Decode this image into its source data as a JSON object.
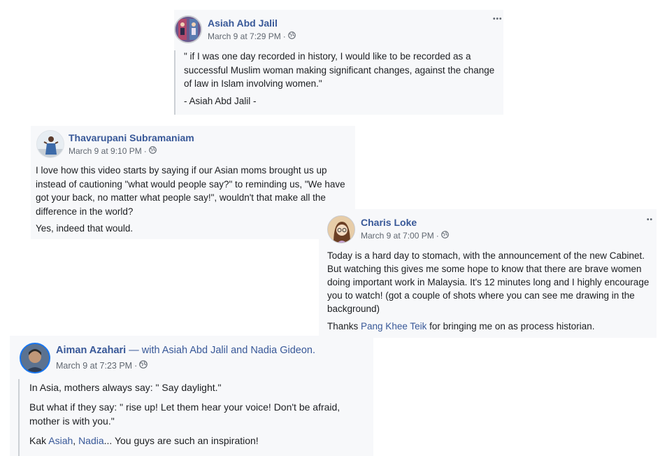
{
  "posts": [
    {
      "author": "Asiah Abd Jalil",
      "time": "March 9 at 7:29 PM",
      "separator": "·",
      "lines": [
        "\" if I was one day recorded in history, I would like to be recorded as a",
        "successful Muslim woman making significant changes, against the change",
        "of law in Islam involving women.\""
      ],
      "signature": "- Asiah Abd Jalil -",
      "more": "•••",
      "avatar_icon": "profile-photo",
      "privacy_icon": "globe-icon"
    },
    {
      "author": "Thavarupani Subramaniam",
      "time": "March 9 at 9:10 PM",
      "separator": "·",
      "lines": [
        "I love how this video starts by saying if our Asian moms brought us up",
        "instead of cautioning \"what would people say?\" to reminding us, \"We have",
        "got your back, no matter what people say!\", wouldn't that make all the",
        "difference in the world?"
      ],
      "followup": "Yes, indeed that would.",
      "avatar_icon": "profile-photo",
      "privacy_icon": "globe-icon"
    },
    {
      "author": "Charis Loke",
      "time": "March 9 at 7:00 PM",
      "separator": "·",
      "lines": [
        "Today is a hard day to stomach, with the announcement of the new Cabinet.",
        "But watching this gives me some hope to know that there are brave women",
        "doing important work in Malaysia. It's 12 minutes long and I highly encourage",
        "you to watch! (got a couple of shots where you can see me drawing in the",
        "background)"
      ],
      "thanks_prefix": "Thanks ",
      "thanks_link": "Pang Khee Teik",
      "thanks_suffix": " for bringing me on as process historian.",
      "more": "••",
      "avatar_icon": "profile-photo",
      "privacy_icon": "globe-icon"
    },
    {
      "author": "Aiman Azahari",
      "with_text": " — with ",
      "tag1": "Asiah Abd Jalil",
      "and_text": " and ",
      "tag2": "Nadia Gideon",
      "period": ".",
      "time": "March 9 at 7:23 PM",
      "separator": "·",
      "line1": "In Asia, mothers always say: \" Say daylight.\"",
      "line2a": "But what if they say: \" rise up! Let them hear your voice! Don't be afraid,",
      "line2b": "mother is with you.\"",
      "kak": "Kak ",
      "mention1": "Asiah",
      "comma": ", ",
      "mention2": "Nadia",
      "closing": "... You guys are such an inspiration!",
      "avatar_icon": "profile-photo",
      "privacy_icon": "globe-icon"
    }
  ]
}
